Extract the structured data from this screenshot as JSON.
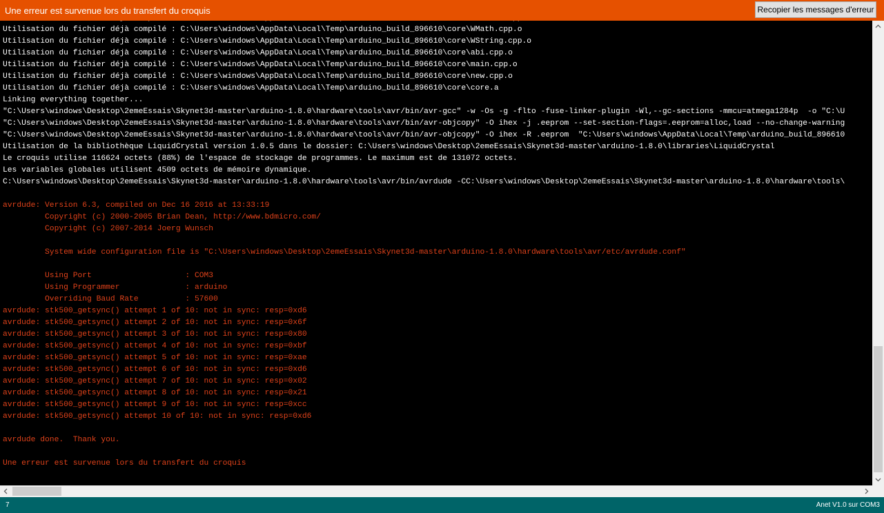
{
  "error_bar": {
    "title": "Une erreur est survenue lors du transfert du croquis",
    "copy_button_label": "Recopier les messages d'erreur"
  },
  "console": {
    "lines": [
      {
        "text": "Utilisation du fichier déjà compilé : C:\\Users\\windows\\AppData\\Local\\Temp\\arduino_build_896610\\core\\USBCore.cpp.o",
        "type": "w"
      },
      {
        "text": "Utilisation du fichier déjà compilé : C:\\Users\\windows\\AppData\\Local\\Temp\\arduino_build_896610\\core\\WMath.cpp.o",
        "type": "w"
      },
      {
        "text": "Utilisation du fichier déjà compilé : C:\\Users\\windows\\AppData\\Local\\Temp\\arduino_build_896610\\core\\WString.cpp.o",
        "type": "w"
      },
      {
        "text": "Utilisation du fichier déjà compilé : C:\\Users\\windows\\AppData\\Local\\Temp\\arduino_build_896610\\core\\abi.cpp.o",
        "type": "w"
      },
      {
        "text": "Utilisation du fichier déjà compilé : C:\\Users\\windows\\AppData\\Local\\Temp\\arduino_build_896610\\core\\main.cpp.o",
        "type": "w"
      },
      {
        "text": "Utilisation du fichier déjà compilé : C:\\Users\\windows\\AppData\\Local\\Temp\\arduino_build_896610\\core\\new.cpp.o",
        "type": "w"
      },
      {
        "text": "Utilisation du fichier déjà compilé : C:\\Users\\windows\\AppData\\Local\\Temp\\arduino_build_896610\\core\\core.a",
        "type": "w"
      },
      {
        "text": "Linking everything together...",
        "type": "w"
      },
      {
        "text": "\"C:\\Users\\windows\\Desktop\\2emeEssais\\Skynet3d-master\\arduino-1.8.0\\hardware\\tools\\avr/bin/avr-gcc\" -w -Os -g -flto -fuse-linker-plugin -Wl,--gc-sections -mmcu=atmega1284p  -o \"C:\\U",
        "type": "w"
      },
      {
        "text": "\"C:\\Users\\windows\\Desktop\\2emeEssais\\Skynet3d-master\\arduino-1.8.0\\hardware\\tools\\avr/bin/avr-objcopy\" -O ihex -j .eeprom --set-section-flags=.eeprom=alloc,load --no-change-warning",
        "type": "w"
      },
      {
        "text": "\"C:\\Users\\windows\\Desktop\\2emeEssais\\Skynet3d-master\\arduino-1.8.0\\hardware\\tools\\avr/bin/avr-objcopy\" -O ihex -R .eeprom  \"C:\\Users\\windows\\AppData\\Local\\Temp\\arduino_build_896610",
        "type": "w"
      },
      {
        "text": "Utilisation de la bibliothèque LiquidCrystal version 1.0.5 dans le dossier: C:\\Users\\windows\\Desktop\\2emeEssais\\Skynet3d-master\\arduino-1.8.0\\libraries\\LiquidCrystal",
        "type": "w"
      },
      {
        "text": "Le croquis utilise 116624 octets (88%) de l'espace de stockage de programmes. Le maximum est de 131072 octets.",
        "type": "w"
      },
      {
        "text": "Les variables globales utilisent 4509 octets de mémoire dynamique.",
        "type": "w"
      },
      {
        "text": "C:\\Users\\windows\\Desktop\\2emeEssais\\Skynet3d-master\\arduino-1.8.0\\hardware\\tools\\avr/bin/avrdude -CC:\\Users\\windows\\Desktop\\2emeEssais\\Skynet3d-master\\arduino-1.8.0\\hardware\\tools\\",
        "type": "w"
      },
      {
        "text": "",
        "type": "w"
      },
      {
        "text": "avrdude: Version 6.3, compiled on Dec 16 2016 at 13:33:19",
        "type": "e"
      },
      {
        "text": "         Copyright (c) 2000-2005 Brian Dean, http://www.bdmicro.com/",
        "type": "e"
      },
      {
        "text": "         Copyright (c) 2007-2014 Joerg Wunsch",
        "type": "e"
      },
      {
        "text": "",
        "type": "e"
      },
      {
        "text": "         System wide configuration file is \"C:\\Users\\windows\\Desktop\\2emeEssais\\Skynet3d-master\\arduino-1.8.0\\hardware\\tools\\avr/etc/avrdude.conf\"",
        "type": "e"
      },
      {
        "text": "",
        "type": "e"
      },
      {
        "text": "         Using Port                    : COM3",
        "type": "e"
      },
      {
        "text": "         Using Programmer              : arduino",
        "type": "e"
      },
      {
        "text": "         Overriding Baud Rate          : 57600",
        "type": "e"
      },
      {
        "text": "avrdude: stk500_getsync() attempt 1 of 10: not in sync: resp=0xd6",
        "type": "e"
      },
      {
        "text": "avrdude: stk500_getsync() attempt 2 of 10: not in sync: resp=0x6f",
        "type": "e"
      },
      {
        "text": "avrdude: stk500_getsync() attempt 3 of 10: not in sync: resp=0x80",
        "type": "e"
      },
      {
        "text": "avrdude: stk500_getsync() attempt 4 of 10: not in sync: resp=0xbf",
        "type": "e"
      },
      {
        "text": "avrdude: stk500_getsync() attempt 5 of 10: not in sync: resp=0xae",
        "type": "e"
      },
      {
        "text": "avrdude: stk500_getsync() attempt 6 of 10: not in sync: resp=0xd6",
        "type": "e"
      },
      {
        "text": "avrdude: stk500_getsync() attempt 7 of 10: not in sync: resp=0x02",
        "type": "e"
      },
      {
        "text": "avrdude: stk500_getsync() attempt 8 of 10: not in sync: resp=0x21",
        "type": "e"
      },
      {
        "text": "avrdude: stk500_getsync() attempt 9 of 10: not in sync: resp=0xcc",
        "type": "e"
      },
      {
        "text": "avrdude: stk500_getsync() attempt 10 of 10: not in sync: resp=0xd6",
        "type": "e"
      },
      {
        "text": "",
        "type": "e"
      },
      {
        "text": "avrdude done.  Thank you.",
        "type": "e"
      },
      {
        "text": "",
        "type": "e"
      },
      {
        "text": "Une erreur est survenue lors du transfert du croquis",
        "type": "e"
      }
    ]
  },
  "status_bar": {
    "line_number": "7",
    "board_info": "Anet V1.0 sur COM3"
  },
  "colors": {
    "error_bar": "#e65100",
    "console_background": "#000000",
    "console_text": "#ffffff",
    "console_error_text": "#e0421a",
    "status_bar": "#006468"
  },
  "icons": {
    "scroll_up": "chevron-up-icon",
    "scroll_down": "chevron-down-icon",
    "scroll_left": "chevron-left-icon",
    "scroll_right": "chevron-right-icon"
  }
}
